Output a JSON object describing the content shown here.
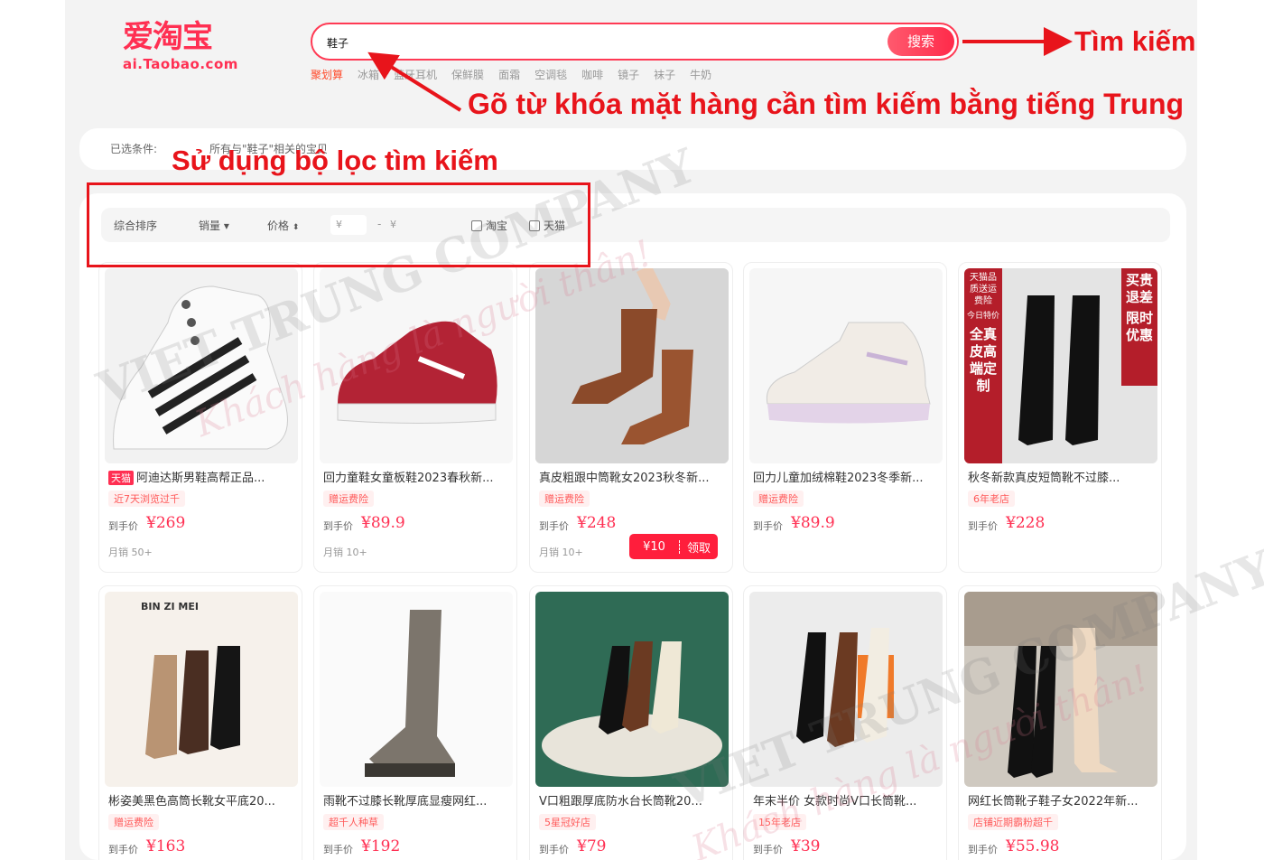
{
  "logo": {
    "main": "爱淘宝",
    "sub": "ai.Taobao.com"
  },
  "search": {
    "value": "鞋子",
    "button": "搜索"
  },
  "hot_words": [
    "聚划算",
    "冰箱",
    "蓝牙耳机",
    "保鲜膜",
    "面霜",
    "空调毯",
    "咖啡",
    "镜子",
    "袜子",
    "牛奶"
  ],
  "selected_conditions": {
    "label": "已选条件:",
    "value": "所有与\"鞋子\"相关的宝贝"
  },
  "filters": {
    "sort_default": "综合排序",
    "sort_sales": "销量",
    "sort_price": "价格",
    "price_min_placeholder": "¥",
    "price_max_placeholder": "¥",
    "taobao": "淘宝",
    "tmall": "天猫"
  },
  "products": [
    {
      "badge": "天猫",
      "title": "阿迪达斯男鞋高帮正品...",
      "tag": "近7天浏览过千",
      "price_label": "到手价",
      "price": "¥269",
      "sales": "月销 50+"
    },
    {
      "title": "回力童鞋女童板鞋2023春秋新...",
      "tag": "赠运费险",
      "price_label": "到手价",
      "price": "¥89.9",
      "sales": "月销 10+"
    },
    {
      "title": "真皮粗跟中筒靴女2023秋冬新...",
      "tag": "赠运费险",
      "price_label": "到手价",
      "price": "¥248",
      "sales": "月销 10+",
      "coupon_amount": "¥10",
      "coupon_action": "领取"
    },
    {
      "title": "回力儿童加绒棉鞋2023冬季新...",
      "tag": "赠运费险",
      "price_label": "到手价",
      "price": "¥89.9"
    },
    {
      "title": "秋冬新款真皮短筒靴不过膝...",
      "tag": "6年老店",
      "price_label": "到手价",
      "price": "¥228"
    },
    {
      "title": "彬姿美黑色高筒长靴女平底20...",
      "tag": "赠运费险",
      "price_label": "到手价",
      "price": "¥163"
    },
    {
      "title": "雨靴不过膝长靴厚底显瘦网红...",
      "tag": "超千人种草",
      "price_label": "到手价",
      "price": "¥192"
    },
    {
      "title": "V口粗跟厚底防水台长筒靴20...",
      "tag": "5星冠好店",
      "price_label": "到手价",
      "price": "¥79"
    },
    {
      "title": "年末半价 女款时尚V口长筒靴...",
      "tag": "15年老店",
      "price_label": "到手价",
      "price": "¥39"
    },
    {
      "title": "网红长筒靴子鞋子女2022年新...",
      "tag": "店铺近期霸粉超千",
      "price_label": "到手价",
      "price": "¥55.98"
    }
  ],
  "product_image_texts": {
    "binzimei": "BIN ZI MEI",
    "p5_left": "天猫品质送运费险",
    "p5_left2": "今日特价",
    "p5_left3": "全真皮高端定制",
    "p5_right": "买贵退差",
    "p5_right2": "限时优惠"
  },
  "annotations": {
    "search_button_note": "Tìm kiếm",
    "keyword_note": "Gõ từ khóa mặt hàng cần tìm kiếm bằng tiếng Trung",
    "filter_note": "Sử dụng bộ lọc tìm kiếm"
  },
  "watermark": {
    "company": "VIET TRUNG COMPANY",
    "slogan": "Khách hàng là người thân!"
  },
  "colors": {
    "brand": "#ff2f52",
    "annotation": "#e8141b"
  }
}
